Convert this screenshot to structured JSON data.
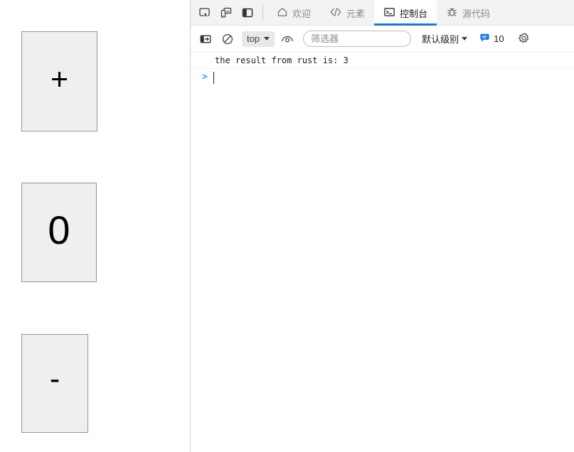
{
  "page": {
    "increment_button": {
      "label": "+",
      "icon": "plus-icon"
    },
    "counter_display": {
      "value": "0"
    },
    "decrement_button": {
      "label": "-",
      "icon": "minus-icon"
    }
  },
  "devtools": {
    "tools": [
      {
        "name": "inspect-element-icon",
        "title": "检查元素"
      },
      {
        "name": "device-toolbar-icon",
        "title": "设备工具栏"
      },
      {
        "name": "dock-side-icon",
        "title": "停靠位置"
      }
    ],
    "tabs": [
      {
        "id": "welcome",
        "label": "欢迎",
        "icon": "home-icon",
        "active": false
      },
      {
        "id": "elements",
        "label": "元素",
        "icon": "code-brackets-icon",
        "active": false
      },
      {
        "id": "console",
        "label": "控制台",
        "icon": "console-terminal-icon",
        "active": true
      },
      {
        "id": "sources",
        "label": "源代码",
        "icon": "bug-icon",
        "active": false
      }
    ],
    "active_tab": "控制台",
    "accent_color": "#1a73e8",
    "toolbar": {
      "sidebar_toggle": {
        "name": "console-sidebar-icon"
      },
      "clear_console": {
        "name": "clear-console-icon"
      },
      "context_selector": {
        "value": "top",
        "name": "javascript-context-select"
      },
      "live_expression": {
        "name": "eye-live-expression-icon"
      },
      "filter": {
        "placeholder": "筛选器",
        "value": ""
      },
      "level_selector": {
        "value": "默认级别"
      },
      "issues": {
        "count": "10",
        "icon": "issues-bubble-icon"
      },
      "settings": {
        "name": "gear-icon"
      }
    },
    "console": {
      "messages": [
        {
          "text": "the result from rust is: 3",
          "level": "log"
        }
      ],
      "prompt_symbol": ">",
      "prompt_value": ""
    }
  }
}
